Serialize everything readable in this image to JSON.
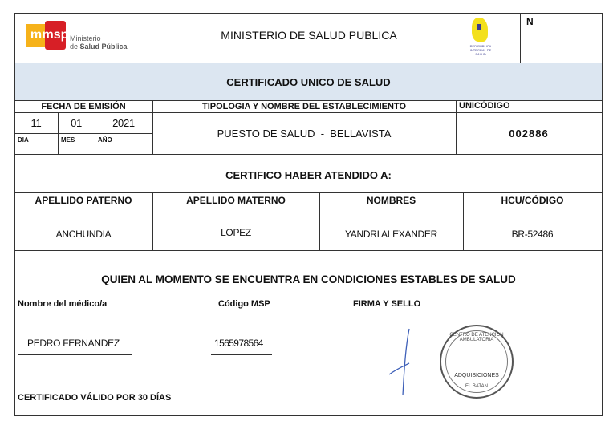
{
  "header": {
    "logo_msp": "msp",
    "logo_line1": "Ministerio",
    "logo_line2a": "de ",
    "logo_line2b": "Salud Pública",
    "title": "MINISTERIO DE SALUD PUBLICA",
    "right_logo_text": "RED PÚBLICA INTEGRAL DE SALUD",
    "n_label": "N"
  },
  "banner": {
    "title": "CERTIFICADO UNICO DE SALUD",
    "color": "#dce6f1"
  },
  "establishment": {
    "fecha_label": "FECHA DE EMISIÓN",
    "tipologia_label": "TIPOLOGIA Y NOMBRE DEL ESTABLECIMIENTO",
    "unicodigo_label": "UNICÓDIGO",
    "dia": "11",
    "mes": "01",
    "anio": "2021",
    "dia_label": "DIA",
    "mes_label": "MES",
    "anio_label": "AÑO",
    "nombre": "PUESTO DE SALUD  -  BELLAVISTA",
    "unicodigo": "002886"
  },
  "certifico": "CERTIFICO HABER ATENDIDO A:",
  "patient": {
    "headers": [
      "APELLIDO PATERNO",
      "APELLIDO MATERNO",
      "NOMBRES",
      "HCU/CÓDIGO"
    ],
    "values": [
      "ANCHUNDIA",
      "LOPEZ",
      "YANDRI ALEXANDER",
      "BR-52486"
    ]
  },
  "condition": "QUIEN AL MOMENTO SE ENCUENTRA EN CONDICIONES ESTABLES DE SALUD",
  "doctor": {
    "name_label": "Nombre del médico/a",
    "code_label": "Código MSP",
    "firma_label": "FIRMA Y SELLO",
    "name": "PEDRO FERNANDEZ",
    "code": "1565978564",
    "stamp_text": "CENTRO DE ATENCION AMBULATORIA",
    "stamp_center": "ADQUISICIONES",
    "stamp_bottom": "EL BATAN"
  },
  "validity": "CERTIFICADO VÁLIDO POR 30 DÍAS"
}
